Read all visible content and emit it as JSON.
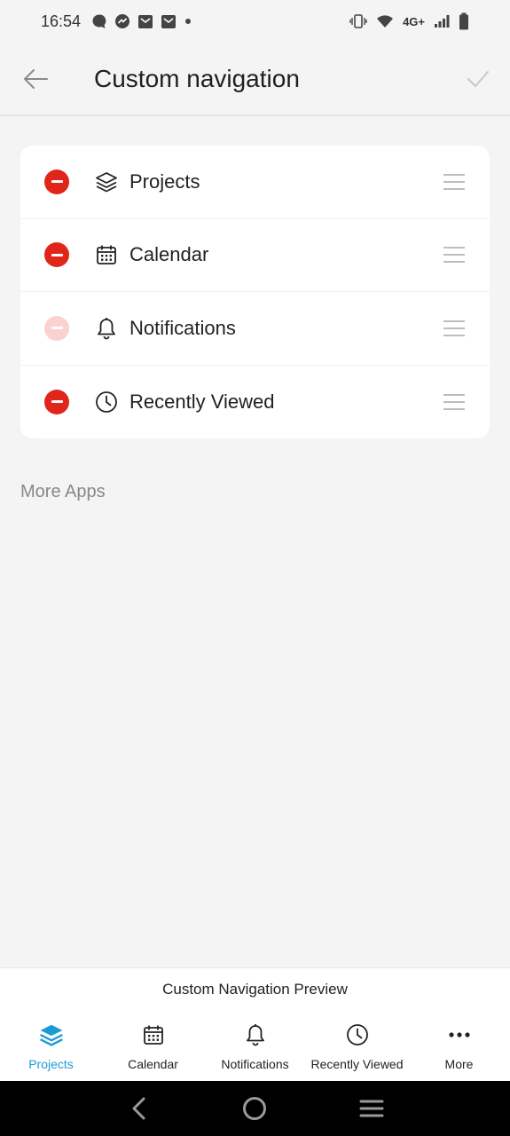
{
  "status_bar": {
    "time": "16:54",
    "network": "4G+",
    "left_icons": [
      "chat-icon",
      "messenger-icon",
      "mail-icon",
      "mail-icon",
      "dot-icon"
    ],
    "right_icons": [
      "vibrate-icon",
      "wifi-icon",
      "signal-icon",
      "battery-icon"
    ]
  },
  "app_bar": {
    "title": "Custom navigation",
    "back_icon": "arrow-left-icon",
    "confirm_icon": "check-icon"
  },
  "nav_items": [
    {
      "label": "Projects",
      "icon": "layers-icon",
      "removable": true
    },
    {
      "label": "Calendar",
      "icon": "calendar-icon",
      "removable": true
    },
    {
      "label": "Notifications",
      "icon": "bell-icon",
      "removable": false
    },
    {
      "label": "Recently Viewed",
      "icon": "clock-icon",
      "removable": true
    }
  ],
  "more_apps_label": "More Apps",
  "preview": {
    "title": "Custom Navigation Preview",
    "tabs": [
      {
        "label": "Projects",
        "icon": "layers-icon",
        "active": true
      },
      {
        "label": "Calendar",
        "icon": "calendar-icon",
        "active": false
      },
      {
        "label": "Notifications",
        "icon": "bell-icon",
        "active": false
      },
      {
        "label": "Recently Viewed",
        "icon": "clock-icon",
        "active": false
      },
      {
        "label": "More",
        "icon": "more-icon",
        "active": false
      }
    ]
  },
  "colors": {
    "accent": "#1b9ad6",
    "remove": "#e0261b",
    "remove_disabled": "#fbd2d0",
    "background": "#f4f4f4"
  }
}
